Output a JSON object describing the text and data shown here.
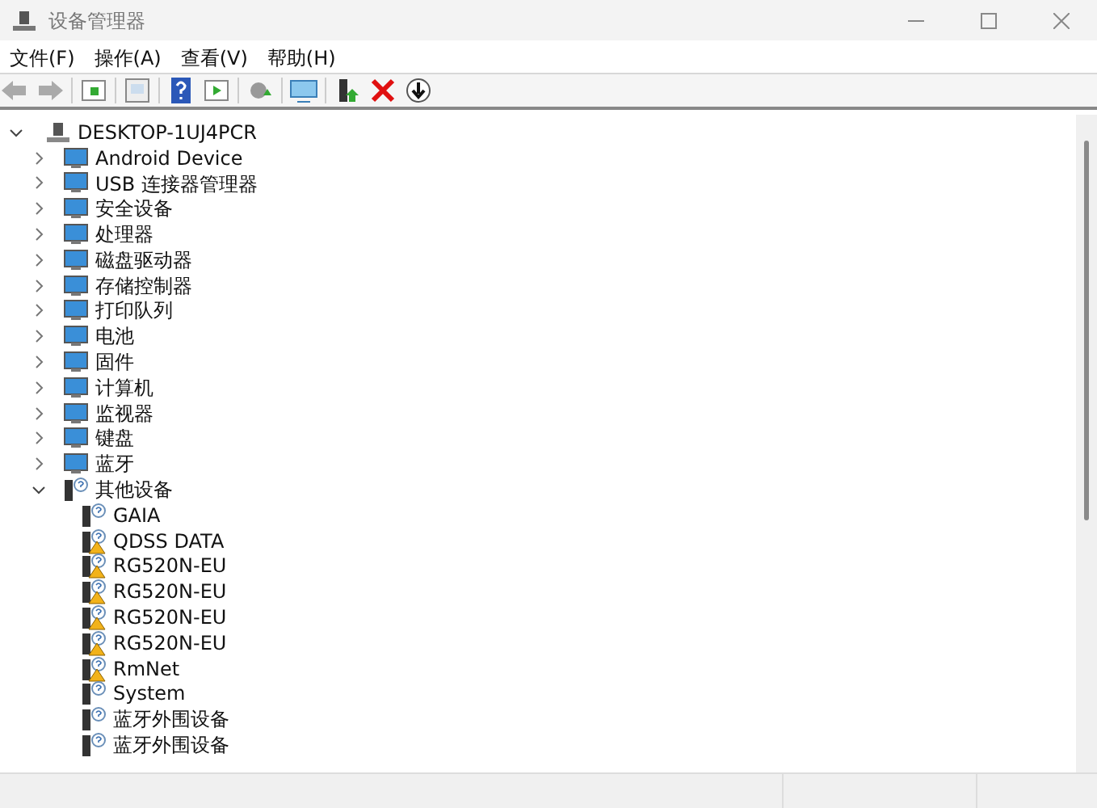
{
  "window": {
    "title": "设备管理器"
  },
  "menu": [
    {
      "label": "文件(F)"
    },
    {
      "label": "操作(A)"
    },
    {
      "label": "查看(V)"
    },
    {
      "label": "帮助(H)"
    }
  ],
  "tree": {
    "label": "DESKTOP-1UJ4PCR",
    "expanded": true,
    "children": [
      {
        "label": "Android Device",
        "expanded": false
      },
      {
        "label": "USB 连接器管理器",
        "expanded": false
      },
      {
        "label": "安全设备",
        "expanded": false
      },
      {
        "label": "处理器",
        "expanded": false
      },
      {
        "label": "磁盘驱动器",
        "expanded": false
      },
      {
        "label": "存储控制器",
        "expanded": false
      },
      {
        "label": "打印队列",
        "expanded": false
      },
      {
        "label": "电池",
        "expanded": false
      },
      {
        "label": "固件",
        "expanded": false
      },
      {
        "label": "计算机",
        "expanded": false
      },
      {
        "label": "监视器",
        "expanded": false
      },
      {
        "label": "键盘",
        "expanded": false
      },
      {
        "label": "蓝牙",
        "expanded": false
      },
      {
        "label": "其他设备",
        "expanded": true,
        "children": [
          {
            "label": "GAIA",
            "warning": false
          },
          {
            "label": "QDSS DATA",
            "warning": true
          },
          {
            "label": "RG520N-EU",
            "warning": true
          },
          {
            "label": "RG520N-EU",
            "warning": true
          },
          {
            "label": "RG520N-EU",
            "warning": true
          },
          {
            "label": "RG520N-EU",
            "warning": true
          },
          {
            "label": "RmNet",
            "warning": true
          },
          {
            "label": "System",
            "warning": false
          },
          {
            "label": "蓝牙外围设备",
            "warning": false
          },
          {
            "label": "蓝牙外围设备",
            "warning": false
          }
        ]
      }
    ]
  }
}
